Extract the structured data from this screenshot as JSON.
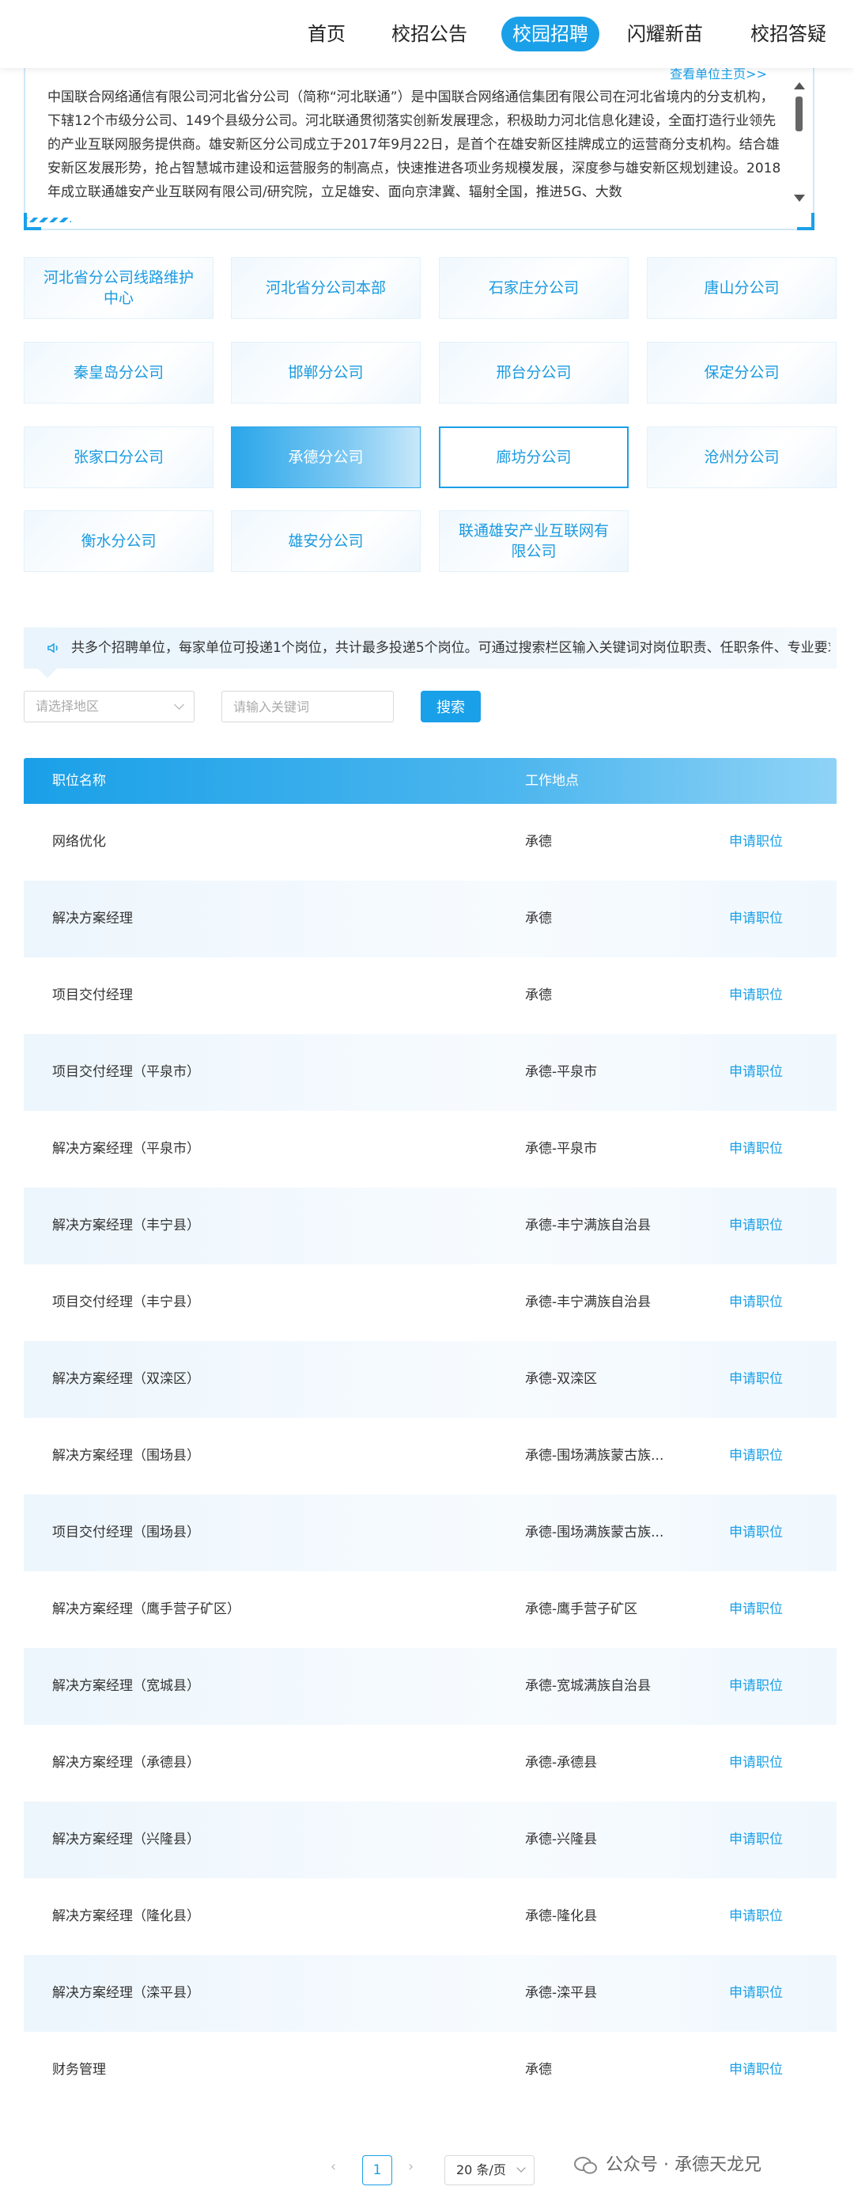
{
  "nav": {
    "items": [
      {
        "label": "首页"
      },
      {
        "label": "校招公告"
      },
      {
        "label": "校园招聘"
      },
      {
        "label": "闪耀新苗"
      },
      {
        "label": "校招答疑"
      }
    ],
    "active_index": 2
  },
  "intro": {
    "link_label": "查看单位主页>>",
    "text": "中国联合网络通信有限公司河北省分公司（简称“河北联通”）是中国联合网络通信集团有限公司在河北省境内的分支机构，下辖12个市级分公司、149个县级分公司。河北联通贯彻落实创新发展理念，积极助力河北信息化建设，全面打造行业领先的产业互联网服务提供商。雄安新区分公司成立于2017年9月22日，是首个在雄安新区挂牌成立的运营商分支机构。结合雄安新区发展形势，抢占智慧城市建设和运营服务的制高点，快速推进各项业务规模发展，深度参与雄安新区规划建设。2018年成立联通雄安产业互联网有限公司/研究院，立足雄安、面向京津冀、辐射全国，推进5G、大数"
  },
  "branches": [
    {
      "label": "河北省分公司线路维护中心"
    },
    {
      "label": "河北省分公司本部"
    },
    {
      "label": "石家庄分公司"
    },
    {
      "label": "唐山分公司"
    },
    {
      "label": "秦皇岛分公司"
    },
    {
      "label": "邯郸分公司"
    },
    {
      "label": "邢台分公司"
    },
    {
      "label": "保定分公司"
    },
    {
      "label": "张家口分公司"
    },
    {
      "label": "承德分公司"
    },
    {
      "label": "廊坊分公司"
    },
    {
      "label": "沧州分公司"
    },
    {
      "label": "衡水分公司"
    },
    {
      "label": "雄安分公司"
    },
    {
      "label": "联通雄安产业互联网有限公司"
    }
  ],
  "active_branch": "承德分公司",
  "notice": {
    "text": "共多个招聘单位，每家单位可投递1个岗位，共计最多投递5个岗位。可通过搜索栏区输入关键词对岗位职责、任职条件、专业要求进行搜索。"
  },
  "filters": {
    "region_placeholder": "请选择地区",
    "keyword_placeholder": "请输入关键词",
    "search_label": "搜索"
  },
  "table": {
    "headers": {
      "name": "职位名称",
      "location": "工作地点"
    },
    "action_label": "申请职位",
    "rows": [
      {
        "name": "网络优化",
        "location": "承德"
      },
      {
        "name": "解决方案经理",
        "location": "承德"
      },
      {
        "name": "项目交付经理",
        "location": "承德"
      },
      {
        "name": "项目交付经理（平泉市）",
        "location": "承德-平泉市"
      },
      {
        "name": "解决方案经理（平泉市）",
        "location": "承德-平泉市"
      },
      {
        "name": "解决方案经理（丰宁县）",
        "location": "承德-丰宁满族自治县"
      },
      {
        "name": "项目交付经理（丰宁县）",
        "location": "承德-丰宁满族自治县"
      },
      {
        "name": "解决方案经理（双滦区）",
        "location": "承德-双滦区"
      },
      {
        "name": "解决方案经理（围场县）",
        "location": "承德-围场满族蒙古族..."
      },
      {
        "name": "项目交付经理（围场县）",
        "location": "承德-围场满族蒙古族..."
      },
      {
        "name": "解决方案经理（鹰手营子矿区）",
        "location": "承德-鹰手营子矿区"
      },
      {
        "name": "解决方案经理（宽城县）",
        "location": "承德-宽城满族自治县"
      },
      {
        "name": "解决方案经理（承德县）",
        "location": "承德-承德县"
      },
      {
        "name": "解决方案经理（兴隆县）",
        "location": "承德-兴隆县"
      },
      {
        "name": "解决方案经理（隆化县）",
        "location": "承德-隆化县"
      },
      {
        "name": "解决方案经理（滦平县）",
        "location": "承德-滦平县"
      },
      {
        "name": "财务管理",
        "location": "承德"
      }
    ]
  },
  "pagination": {
    "prev": "‹",
    "current_page": "1",
    "next": "›",
    "page_size": "20 条/页"
  },
  "watermark": {
    "text": "公众号 · 承德天龙兄"
  },
  "colors": {
    "accent": "#1aa0e8",
    "row_alt": "#edf6fd"
  }
}
